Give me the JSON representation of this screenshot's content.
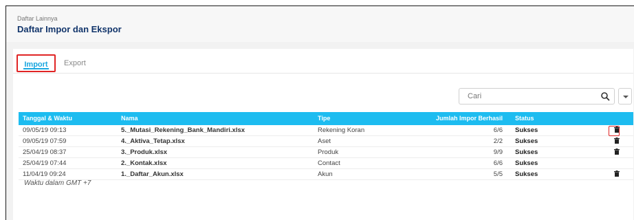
{
  "header": {
    "subtitle": "Daftar Lainnya",
    "title": "Daftar Impor dan Ekspor"
  },
  "tabs": [
    {
      "label": "Import",
      "active": true
    },
    {
      "label": "Export",
      "active": false
    }
  ],
  "search": {
    "placeholder": "Cari",
    "icon": "search-icon"
  },
  "table": {
    "columns": [
      "Tanggal & Waktu",
      "Nama",
      "Tipe",
      "Jumlah Impor Berhasil",
      "Status"
    ],
    "rows": [
      {
        "date": "09/05/19 09:13",
        "name": "5._Mutasi_Rekening_Bank_Mandiri.xlsx",
        "type": "Rekening Koran",
        "count": "6/6",
        "status": "Sukses",
        "deletable": true
      },
      {
        "date": "09/05/19 07:59",
        "name": "4._Aktiva_Tetap.xlsx",
        "type": "Aset",
        "count": "2/2",
        "status": "Sukses",
        "deletable": true
      },
      {
        "date": "25/04/19 08:37",
        "name": "3._Produk.xlsx",
        "type": "Produk",
        "count": "9/9",
        "status": "Sukses",
        "deletable": true
      },
      {
        "date": "25/04/19 07:44",
        "name": "2._Kontak.xlsx",
        "type": "Contact",
        "count": "6/6",
        "status": "Sukses",
        "deletable": false
      },
      {
        "date": "11/04/19 09:24",
        "name": "1._Daftar_Akun.xlsx",
        "type": "Akun",
        "count": "5/5",
        "status": "Sukses",
        "deletable": true
      }
    ]
  },
  "footnote": "Waktu dalam GMT +7",
  "colors": {
    "header_bg": "#1dbcf0",
    "accent": "#1aa6df",
    "title": "#12356b",
    "highlight": "#e02424"
  }
}
